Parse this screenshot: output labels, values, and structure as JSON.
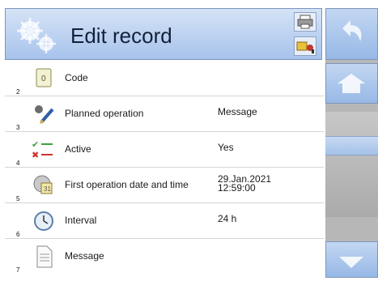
{
  "header": {
    "title": "Edit record"
  },
  "rows": [
    {
      "number": "2",
      "label": "Code",
      "value": "",
      "icon": "code-icon"
    },
    {
      "number": "3",
      "label": "Planned operation",
      "value": "Message",
      "icon": "planned-operation-icon"
    },
    {
      "number": "4",
      "label": "Active",
      "value": "Yes",
      "icon": "active-toggle-icon"
    },
    {
      "number": "5",
      "label": "First operation date and time",
      "value": "29.Jan.2021\n12:59:00",
      "icon": "calendar-icon"
    },
    {
      "number": "6",
      "label": "Interval",
      "value": "24 h",
      "icon": "clock-icon"
    },
    {
      "number": "7",
      "label": "Message",
      "value": "",
      "icon": "document-icon"
    }
  ],
  "sidebar": {
    "buttons": [
      "back-arrow-icon",
      "home-icon",
      "scroll-down-icon"
    ]
  },
  "colors": {
    "header_top": "#d5e3f6",
    "header_bottom": "#a7c3ec",
    "sidebar_bg": "#b7b7b7",
    "row_divider": "#d6d6d6"
  }
}
